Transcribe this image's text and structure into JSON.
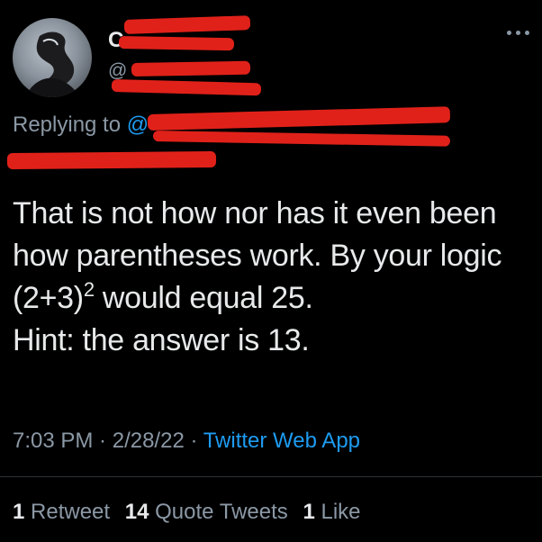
{
  "header": {
    "display_name_visible": "C",
    "handle_visible": "@",
    "more_icon": "more-horizontal-icon"
  },
  "reply": {
    "prefix": "Replying to",
    "mention_visible": "@"
  },
  "tweet": {
    "line1": "That is not how nor has it even been",
    "line2": "how parentheses work. By your logic",
    "line3_pre": "(2+3)",
    "line3_sup": "2",
    "line3_post": " would equal 25.",
    "line4": "Hint: the answer is 13."
  },
  "meta": {
    "time": "7:03 PM",
    "sep1": " · ",
    "date": "2/28/22",
    "sep2": " · ",
    "source": "Twitter Web App"
  },
  "stats": {
    "retweets_count": "1",
    "retweets_label": "Retweet",
    "quotes_count": "14",
    "quotes_label": "Quote Tweets",
    "likes_count": "1",
    "likes_label": "Like"
  },
  "colors": {
    "background": "#000000",
    "text": "#e7e9ea",
    "secondary": "#8b98a5",
    "link": "#1d9bf0",
    "redaction": "#e0211a"
  }
}
